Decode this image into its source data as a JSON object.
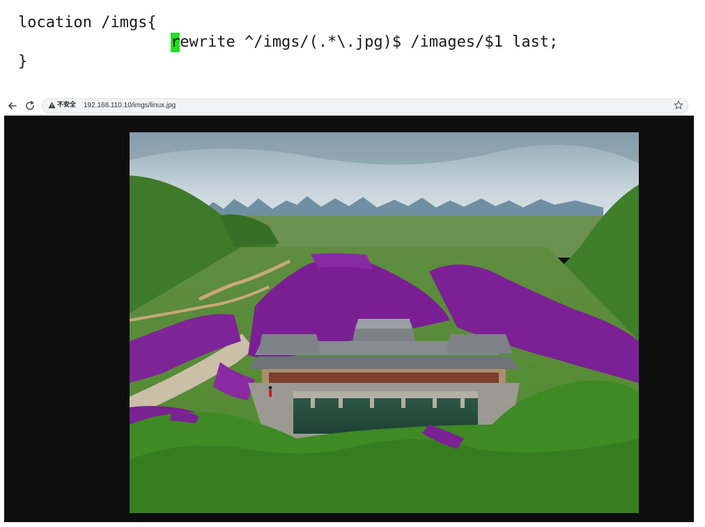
{
  "code": {
    "line1": "location /imgs{",
    "line2_cursor_char": "r",
    "line2_rest": "ewrite ^/imgs/(.*\\.jpg)$ /images/$1 last;",
    "line3": "}"
  },
  "browser": {
    "security_label": "不安全",
    "url": "192.168.110.10/imgs/linux.jpg"
  },
  "icons": {
    "back": "arrow-left-icon",
    "reload": "reload-icon",
    "warning": "warning-triangle-icon",
    "bookmark": "star-icon"
  },
  "colors": {
    "cursor_highlight": "#22dd22",
    "viewer_background": "#0e0e0e"
  }
}
